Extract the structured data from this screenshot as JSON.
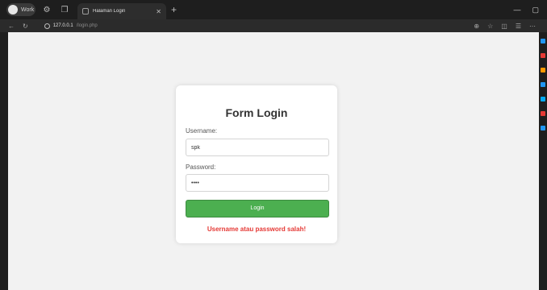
{
  "browser": {
    "profile_label": "Work",
    "tab_title": "Halaman Login",
    "address_host": "127.0.0.1",
    "address_path": "/login.php"
  },
  "form": {
    "title": "Form Login",
    "username_label": "Username:",
    "username_value": "spk",
    "password_label": "Password:",
    "password_value": "••••",
    "login_label": "Login",
    "error_message": "Username atau password salah!"
  },
  "colors": {
    "button": "#4caf50",
    "error": "#e53935",
    "page_bg": "#f2f2f2"
  }
}
